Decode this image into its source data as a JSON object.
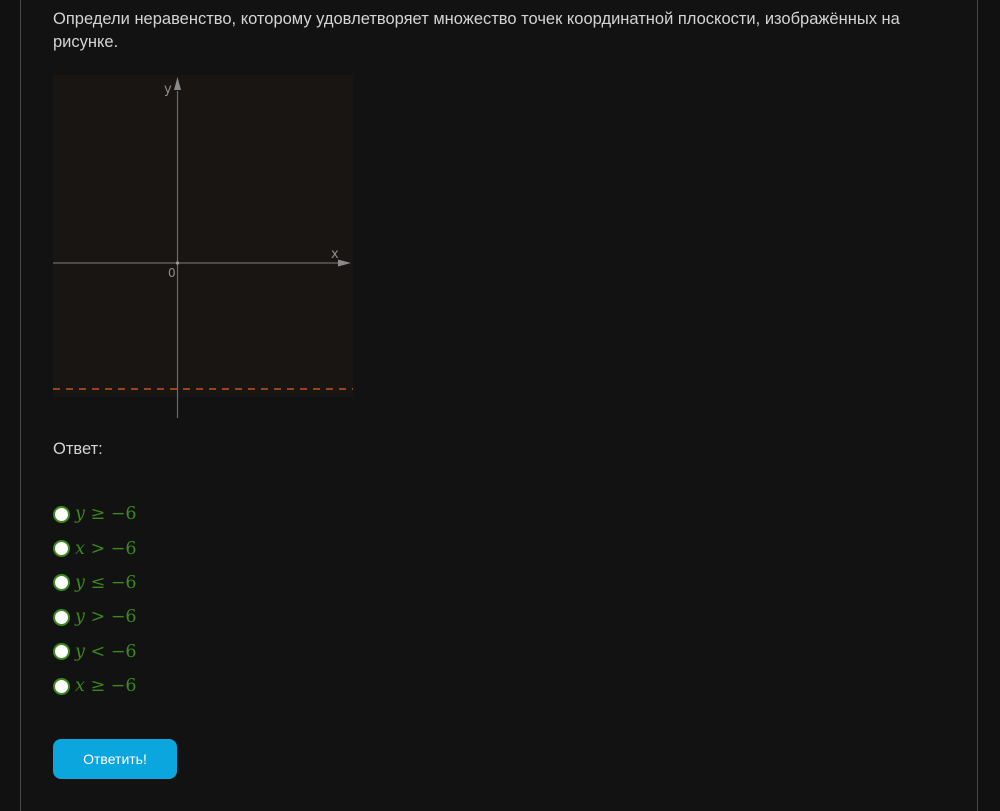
{
  "question": {
    "text": "Определи неравенство, которому удовлетворяет множество точек координатной плоскости, изображённых на рисунке."
  },
  "graph": {
    "x_label": "x",
    "y_label": "y",
    "origin_label": "0",
    "boundary": "dashed",
    "boundary_color": "#c0541c",
    "background": "#181512"
  },
  "answer": {
    "label": "Ответ:"
  },
  "options": [
    {
      "var": "y",
      "rel": " ≥ ",
      "num": "−6"
    },
    {
      "var": "x",
      "rel": " > ",
      "num": "−6"
    },
    {
      "var": "y",
      "rel": " ≤ ",
      "num": "−6"
    },
    {
      "var": "y",
      "rel": " > ",
      "num": "−6"
    },
    {
      "var": "y",
      "rel": " < ",
      "num": "−6"
    },
    {
      "var": "x",
      "rel": " ≥ ",
      "num": "−6"
    }
  ],
  "submit": {
    "label": "Ответить!"
  },
  "colors": {
    "accent_green": "#3c8a1c",
    "button_blue": "#0ba6dd"
  }
}
